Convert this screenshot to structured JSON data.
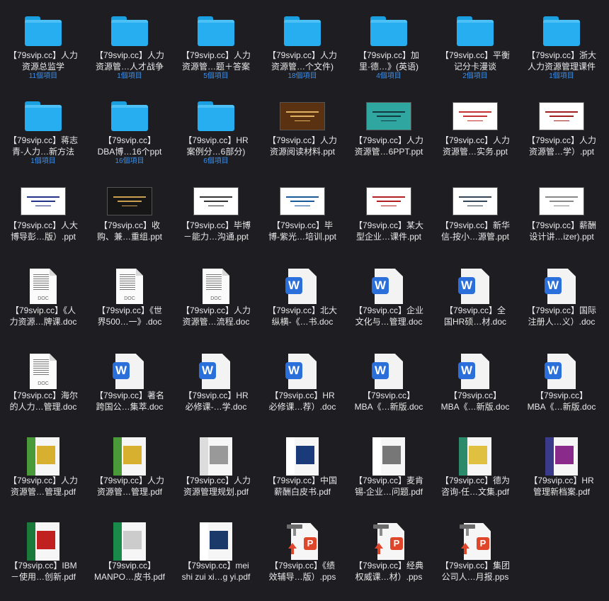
{
  "items": [
    {
      "type": "folder",
      "line1": "【79svip.cc】人力",
      "line2": "资源总监学",
      "count": "11個項目"
    },
    {
      "type": "folder",
      "line1": "【79svip.cc】人力",
      "line2": "资源管…人才战争",
      "count": "1個項目"
    },
    {
      "type": "folder",
      "line1": "【79svip.cc】人力",
      "line2": "资源管…题＋答案",
      "count": "5個項目"
    },
    {
      "type": "folder",
      "line1": "【79svip.cc】人力",
      "line2": "资源管…个文件)",
      "count": "18個項目"
    },
    {
      "type": "folder",
      "line1": "【79svip.cc】加",
      "line2": "里·德…》(英语)",
      "count": "4個項目"
    },
    {
      "type": "folder",
      "line1": "【79svip.cc】平衡",
      "line2": "记分卡漫谈",
      "count": "2個項目"
    },
    {
      "type": "folder",
      "line1": "【79svip.cc】浙大",
      "line2": "人力资源管理课件",
      "count": "1個項目"
    },
    {
      "type": "folder",
      "line1": "【79svip.cc】蒋志",
      "line2": "青-人力…新方法",
      "count": "1個項目"
    },
    {
      "type": "folder",
      "line1": "【79svip.cc】",
      "line2": "DBA博…16个ppt",
      "count": "16個項目"
    },
    {
      "type": "folder",
      "line1": "【79svip.cc】HR",
      "line2": "案例分…6部分)",
      "count": "6個項目"
    },
    {
      "type": "ppt",
      "line1": "【79svip.cc】人力",
      "line2": "资源阅读材料.ppt",
      "bg": "#5a3212",
      "accent": "#e0b060"
    },
    {
      "type": "ppt",
      "line1": "【79svip.cc】人力",
      "line2": "资源管…6PPT.ppt",
      "bg": "#2fa6a0",
      "accent": "#123a40"
    },
    {
      "type": "ppt",
      "line1": "【79svip.cc】人力",
      "line2": "资源管…实务.ppt",
      "bg": "#ffffff",
      "accent": "#c23030"
    },
    {
      "type": "ppt",
      "line1": "【79svip.cc】人力",
      "line2": "资源管…学）.ppt",
      "bg": "#ffffff",
      "accent": "#a02020"
    },
    {
      "type": "ppt",
      "line1": "【79svip.cc】人大",
      "line2": "博导彭…版）.ppt",
      "bg": "#ffffff",
      "accent": "#223388"
    },
    {
      "type": "ppt",
      "line1": "【79svip.cc】收",
      "line2": "购、兼…重组.ppt",
      "bg": "#161616",
      "accent": "#c8a050"
    },
    {
      "type": "ppt",
      "line1": "【79svip.cc】毕博",
      "line2": "－能力…沟通.ppt",
      "bg": "#ffffff",
      "accent": "#333333"
    },
    {
      "type": "ppt",
      "line1": "【79svip.cc】毕",
      "line2": "博-紫光…培训.ppt",
      "bg": "#ffffff",
      "accent": "#1a5a9a"
    },
    {
      "type": "ppt",
      "line1": "【79svip.cc】某大",
      "line2": "型企业…课件.ppt",
      "bg": "#ffffff",
      "accent": "#b02020"
    },
    {
      "type": "ppt",
      "line1": "【79svip.cc】新华",
      "line2": "信-按小…源管.ppt",
      "bg": "#ffffff",
      "accent": "#334455"
    },
    {
      "type": "ppt",
      "line1": "【79svip.cc】薪酬",
      "line2": "设计讲…izer).ppt",
      "bg": "#ffffff",
      "accent": "#888888"
    },
    {
      "type": "doc",
      "line1": "【79svip.cc】《人",
      "line2": "力资源…牌课.doc"
    },
    {
      "type": "doc",
      "line1": "【79svip.cc】《世",
      "line2": "界500…一》.doc"
    },
    {
      "type": "doc",
      "line1": "【79svip.cc】人力",
      "line2": "资源管…流程.doc"
    },
    {
      "type": "word",
      "line1": "【79svip.cc】北大",
      "line2": "纵横-《…书.doc"
    },
    {
      "type": "word",
      "line1": "【79svip.cc】企业",
      "line2": "文化与…管理.doc"
    },
    {
      "type": "word",
      "line1": "【79svip.cc】全",
      "line2": "国HR硕…材.doc"
    },
    {
      "type": "word",
      "line1": "【79svip.cc】国际",
      "line2": "注册人…义）.doc"
    },
    {
      "type": "doc",
      "line1": "【79svip.cc】海尔",
      "line2": "的人力…管理.doc"
    },
    {
      "type": "word",
      "line1": "【79svip.cc】著名",
      "line2": "跨国公…集萃.doc"
    },
    {
      "type": "word",
      "line1": "【79svip.cc】HR",
      "line2": "必修课-…学.doc"
    },
    {
      "type": "word",
      "line1": "【79svip.cc】HR",
      "line2": "必修课…荐）.doc"
    },
    {
      "type": "word",
      "line1": "【79svip.cc】",
      "line2": "MBA《…新版.doc"
    },
    {
      "type": "word",
      "line1": "【79svip.cc】",
      "line2": "MBA《…新版.doc"
    },
    {
      "type": "word",
      "line1": "【79svip.cc】",
      "line2": "MBA《…新版.doc"
    },
    {
      "type": "pdf",
      "line1": "【79svip.cc】人力",
      "line2": "资源管…管理.pdf",
      "band": "#4a9a3a",
      "pic": "#d8b030"
    },
    {
      "type": "pdf",
      "line1": "【79svip.cc】人力",
      "line2": "资源管…管理.pdf",
      "band": "#4a9a3a",
      "pic": "#d8b030"
    },
    {
      "type": "pdf",
      "line1": "【79svip.cc】人力",
      "line2": "资源管理规划.pdf",
      "band": "#dddddd",
      "pic": "#999999"
    },
    {
      "type": "pdf",
      "line1": "【79svip.cc】中国",
      "line2": "薪酬白皮书.pdf",
      "band": "#ffffff",
      "pic": "#1a3a7a"
    },
    {
      "type": "pdf",
      "line1": "【79svip.cc】麦肯",
      "line2": "锡-企业…问题.pdf",
      "band": "#ffffff",
      "pic": "#777777"
    },
    {
      "type": "pdf",
      "line1": "【79svip.cc】德为",
      "line2": "咨询-任…文集.pdf",
      "band": "#2a8a6a",
      "pic": "#e0c040"
    },
    {
      "type": "pdf",
      "line1": "【79svip.cc】HR",
      "line2": "管理新档案.pdf",
      "band": "#3a3a8a",
      "pic": "#8a2a8a"
    },
    {
      "type": "pdf",
      "line1": "【79svip.cc】IBM",
      "line2": "－使用…创新.pdf",
      "band": "#1a7a3a",
      "pic": "#c02020"
    },
    {
      "type": "pdf",
      "line1": "【79svip.cc】",
      "line2": "MANPO…皮书.pdf",
      "band": "#1a8a4a",
      "pic": "#cccccc"
    },
    {
      "type": "pdf",
      "line1": "【79svip.cc】mei",
      "line2": "shi zui xi…g yi.pdf",
      "band": "#ffffff",
      "pic": "#1a3a6a"
    },
    {
      "type": "pps",
      "line1": "【79svip.cc】《绩",
      "line2": "效辅导…版）.pps"
    },
    {
      "type": "pps",
      "line1": "【79svip.cc】经典",
      "line2": "权威课…材）.pps"
    },
    {
      "type": "pps",
      "line1": "【79svip.cc】集团",
      "line2": "公司人…月报.pps"
    }
  ]
}
